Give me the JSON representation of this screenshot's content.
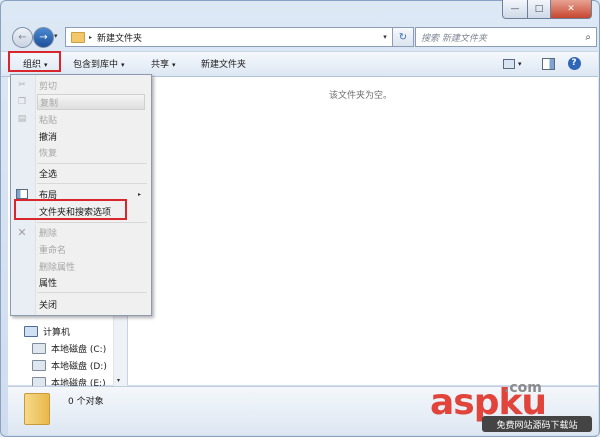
{
  "window": {
    "min_label": "—",
    "max_label": "□",
    "close_label": "✕"
  },
  "navbar": {
    "back_glyph": "←",
    "forward_glyph": "→",
    "history_dropdown_glyph": "▾",
    "address_chevron": "▸",
    "address_text": "新建文件夹",
    "address_dropdown_glyph": "▾",
    "refresh_glyph": "↻",
    "search_placeholder": "搜索 新建文件夹",
    "search_icon_glyph": "⌕"
  },
  "toolbar": {
    "organize": "组织",
    "include_in_library": "包含到库中",
    "share": "共享",
    "new_folder": "新建文件夹",
    "caret": "▾",
    "help_glyph": "?"
  },
  "content": {
    "empty_message": "该文件夹为空。"
  },
  "navpane": {
    "items": [
      {
        "label": "计算机"
      },
      {
        "label": "本地磁盘 (C:)"
      },
      {
        "label": "本地磁盘 (D:)"
      },
      {
        "label": "本地磁盘 (E:)"
      }
    ],
    "scroll_down_glyph": "▾"
  },
  "menu": {
    "items": [
      {
        "label": "剪切",
        "disabled": true,
        "icon": "scissors-icon"
      },
      {
        "label": "复制",
        "disabled": true,
        "icon": "copy-icon",
        "highlighted": true
      },
      {
        "label": "粘贴",
        "disabled": true,
        "icon": "paste-icon"
      },
      {
        "label": "撤消",
        "disabled": false
      },
      {
        "label": "恢复",
        "disabled": true
      },
      {
        "label": "全选",
        "disabled": false
      },
      {
        "label": "布局",
        "disabled": false,
        "icon": "layout-icon",
        "submenu": true
      },
      {
        "label": "文件夹和搜索选项",
        "disabled": false
      },
      {
        "label": "删除",
        "disabled": true,
        "icon": "delete-x-icon"
      },
      {
        "label": "重命名",
        "disabled": true
      },
      {
        "label": "删除属性",
        "disabled": true
      },
      {
        "label": "属性",
        "disabled": false
      },
      {
        "label": "关闭",
        "disabled": false
      }
    ],
    "submenu_glyph": "▸"
  },
  "details": {
    "item_count": "0 个对象"
  },
  "watermark": {
    "brand": "aspku",
    "suffix": ".com",
    "sub_text": "免费网站源码下载站"
  },
  "colors": {
    "highlight_box": "#d9262c",
    "accent": "#2f66b7"
  }
}
